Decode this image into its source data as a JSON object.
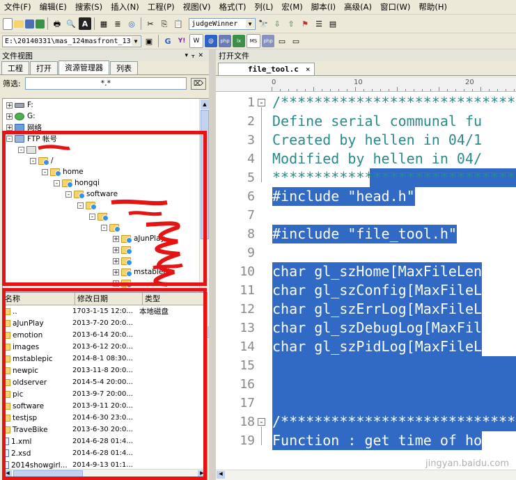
{
  "menubar": {
    "items": [
      "文件(F)",
      "编辑(E)",
      "搜索(S)",
      "插入(N)",
      "工程(P)",
      "视图(V)",
      "格式(T)",
      "列(L)",
      "宏(M)",
      "脚本(I)",
      "高级(A)",
      "窗口(W)",
      "帮助(H)"
    ]
  },
  "toolbar": {
    "macro_combo": "judgeWinner",
    "path_combo": "E:\\20140331\\mas_124masfront_13"
  },
  "left_panel": {
    "title": "文件视图",
    "tabs": [
      "工程",
      "打开",
      "资源管理器",
      "列表"
    ],
    "active_tab": "资源管理器",
    "filter_label": "筛选:",
    "filter_value": "*.*",
    "tree": [
      {
        "label": "F:",
        "level": 0,
        "expander": "+",
        "icon": "drive-icon"
      },
      {
        "label": "G:",
        "level": 0,
        "expander": "+",
        "icon": "network-drive-icon"
      },
      {
        "label": "网络",
        "level": 0,
        "expander": "+",
        "icon": "network-icon"
      },
      {
        "label": "FTP 帐号",
        "level": 0,
        "expander": "-",
        "icon": "ftp-icon"
      },
      {
        "label": "",
        "level": 1,
        "expander": "-",
        "icon": "ftp-server-icon"
      },
      {
        "label": "/",
        "level": 2,
        "expander": "-",
        "icon": "folder-icon"
      },
      {
        "label": "home",
        "level": 3,
        "expander": "-",
        "icon": "folder-icon"
      },
      {
        "label": "hongqi",
        "level": 4,
        "expander": "-",
        "icon": "folder-icon"
      },
      {
        "label": "software",
        "level": 5,
        "expander": "-",
        "icon": "folder-icon"
      },
      {
        "label": "",
        "level": 6,
        "expander": "-",
        "icon": "folder-icon"
      },
      {
        "label": "",
        "level": 7,
        "expander": "-",
        "icon": "folder-icon"
      },
      {
        "label": "",
        "level": 8,
        "expander": "-",
        "icon": "folder-icon"
      },
      {
        "label": "aJunPlay",
        "level": 9,
        "expander": "+",
        "icon": "folder-icon"
      },
      {
        "label": "",
        "level": 9,
        "expander": "+",
        "icon": "folder-icon"
      },
      {
        "label": "",
        "level": 9,
        "expander": "+",
        "icon": "folder-icon"
      },
      {
        "label": "mstablepic",
        "level": 9,
        "expander": "+",
        "icon": "folder-icon"
      },
      {
        "label": "",
        "level": 9,
        "expander": "+",
        "icon": "folder-icon"
      }
    ],
    "list_columns": [
      "名称",
      "修改日期",
      "类型"
    ],
    "list_rows": [
      {
        "name": "..",
        "date": "1703-1-15 12:0...",
        "type": "本地磁盘",
        "icon": "folder-icon"
      },
      {
        "name": "aJunPlay",
        "date": "2013-7-20 20:0...",
        "type": "",
        "icon": "folder-icon"
      },
      {
        "name": "emotion",
        "date": "2013-6-14 20:0...",
        "type": "",
        "icon": "folder-icon"
      },
      {
        "name": "images",
        "date": "2013-6-12 20:0...",
        "type": "",
        "icon": "folder-icon"
      },
      {
        "name": "mstablepic",
        "date": "2014-8-1 08:30...",
        "type": "",
        "icon": "folder-icon"
      },
      {
        "name": "newpic",
        "date": "2013-11-8 20:0...",
        "type": "",
        "icon": "folder-icon"
      },
      {
        "name": "oldserver",
        "date": "2014-5-4 20:00...",
        "type": "",
        "icon": "folder-icon"
      },
      {
        "name": "pic",
        "date": "2013-9-7 20:00...",
        "type": "",
        "icon": "folder-icon"
      },
      {
        "name": "software",
        "date": "2013-9-11 20:0...",
        "type": "",
        "icon": "folder-icon"
      },
      {
        "name": "testjsp",
        "date": "2014-6-30 23:0...",
        "type": "",
        "icon": "folder-icon"
      },
      {
        "name": "TraveBike",
        "date": "2013-6-30 20:0...",
        "type": "",
        "icon": "folder-icon"
      },
      {
        "name": "1.xml",
        "date": "2014-6-28 01:4...",
        "type": "",
        "icon": "file-icon"
      },
      {
        "name": "2.xsd",
        "date": "2014-6-28 01:4...",
        "type": "",
        "icon": "file-icon"
      },
      {
        "name": "2014showgirl...",
        "date": "2014-9-13 01:1...",
        "type": "",
        "icon": "file-icon"
      }
    ]
  },
  "editor": {
    "title": "打开文件",
    "file_tab": "file_tool.c",
    "close_glyph": "×",
    "ruler_marks": [
      "0",
      "10",
      "20"
    ],
    "lines": [
      {
        "n": "1",
        "text": "/*********************************",
        "style": "cmt",
        "fold": "-"
      },
      {
        "n": "2",
        "text": "Define serial communal fu",
        "style": "cmt"
      },
      {
        "n": "3",
        "text": "Created by hellen in 04/1",
        "style": "cmt"
      },
      {
        "n": "4",
        "text": "Modified by hellen in 04/",
        "style": "cmt"
      },
      {
        "n": "5",
        "text": "*********************************",
        "style": "cmt-partsel"
      },
      {
        "n": "6",
        "text": "#include \"head.h\"",
        "style": "sel"
      },
      {
        "n": "7",
        "text": "",
        "style": ""
      },
      {
        "n": "8",
        "text": "#include \"file_tool.h\"",
        "style": "sel"
      },
      {
        "n": "9",
        "text": "",
        "style": ""
      },
      {
        "n": "10",
        "text": "char gl_szHome[MaxFileLen",
        "style": "sel"
      },
      {
        "n": "11",
        "text": "char gl_szConfig[MaxFileL",
        "style": "sel"
      },
      {
        "n": "12",
        "text": "char gl_szErrLog[MaxFileL",
        "style": "sel"
      },
      {
        "n": "13",
        "text": "char gl_szDebugLog[MaxFil",
        "style": "sel"
      },
      {
        "n": "14",
        "text": "char gl_szPidLog[MaxFileL",
        "style": "sel"
      },
      {
        "n": "15",
        "text": "",
        "style": "selfull"
      },
      {
        "n": "16",
        "text": "",
        "style": "selfull"
      },
      {
        "n": "17",
        "text": "",
        "style": "selfull"
      },
      {
        "n": "18",
        "text": "/*********************************",
        "style": "sel",
        "fold": "-"
      },
      {
        "n": "19",
        "text": "Function : get time of ho",
        "style": "sel"
      }
    ]
  },
  "watermark": "jingyan.baidu.com",
  "colors": {
    "selection": "#316ac5",
    "comment": "#2a8a8a",
    "highlight_box": "#e51414"
  }
}
